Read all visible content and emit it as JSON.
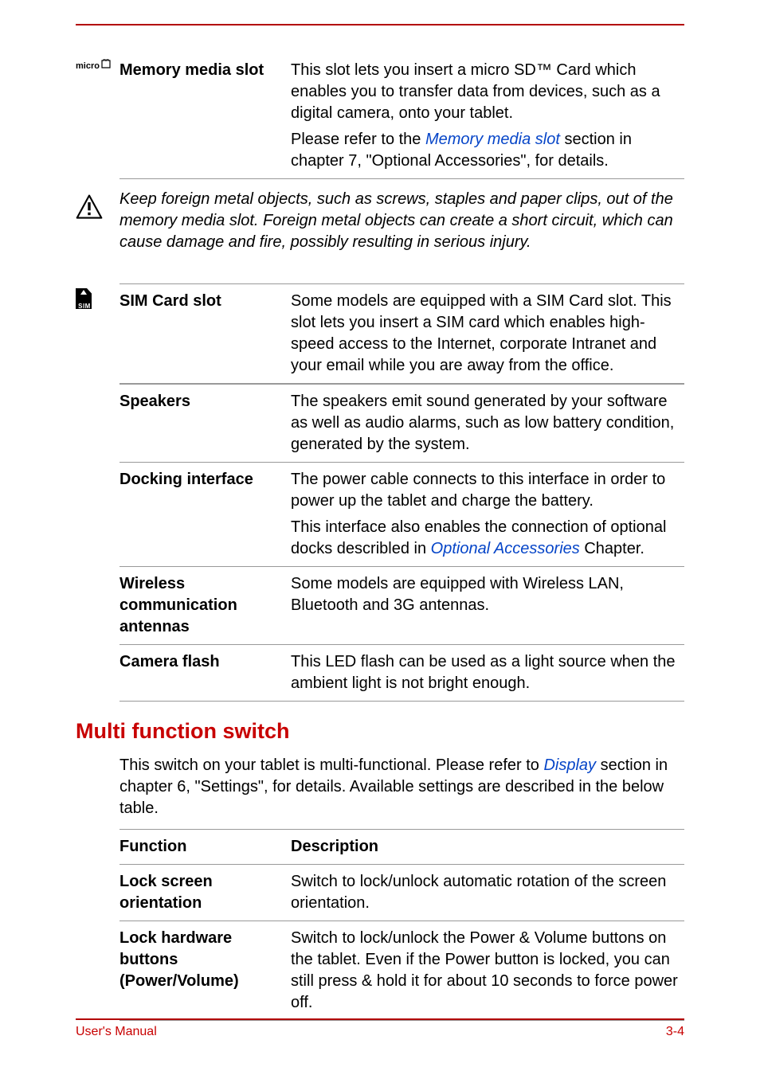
{
  "slot1": {
    "label": "Memory media slot",
    "p1a": "This slot lets you insert a micro SD™ Card which enables you to transfer data from devices, such as a digital camera, onto your tablet.",
    "p2a": "Please refer to the ",
    "p2link": "Memory media slot",
    "p2b": " section in chapter 7, \"Optional Accessories\", for details."
  },
  "warning": {
    "text": "Keep foreign metal objects, such as screws, staples and paper clips, out of the memory media slot. Foreign metal objects can create a short circuit, which can cause damage and fire, possibly resulting in serious injury."
  },
  "sim": {
    "label": "SIM Card slot",
    "p1": "Some models are equipped with a SIM Card slot. This slot lets you insert a SIM card which enables high-speed access to the Internet, corporate Intranet and your email while you are away from the office."
  },
  "speakers": {
    "label": "Speakers",
    "p1": "The speakers emit sound generated by your software as well as audio alarms, such as low battery condition, generated by the system."
  },
  "docking": {
    "label": "Docking interface",
    "p1": "The power cable connects to this interface in order to power up the tablet and charge the battery.",
    "p2a": "This interface also enables the connection of optional docks describled in ",
    "p2link": "Optional Accessories",
    "p2b": " Chapter."
  },
  "wireless": {
    "label": "Wireless communication antennas",
    "p1": "Some models are equipped with Wireless LAN, Bluetooth and 3G antennas."
  },
  "cameraflash": {
    "label": "Camera flash",
    "p1": "This LED flash can be used as a light source when the ambient light is not bright enough."
  },
  "section": {
    "title": "Multi function switch",
    "intro_a": "This switch on your tablet is multi-functional. Please refer to ",
    "intro_link": "Display",
    "intro_b": " section in chapter 6, \"Settings\", for details. Available settings are described in the below table."
  },
  "table": {
    "h_func": "Function",
    "h_desc": "Description",
    "r1_func": "Lock screen orientation",
    "r1_desc": "Switch to lock/unlock automatic rotation of the screen orientation.",
    "r2_func": "Lock hardware buttons (Power/Volume)",
    "r2_desc": "Switch to lock/unlock the Power & Volume buttons on the tablet. Even if the Power button is locked, you can still press & hold it for about 10 seconds to force power off."
  },
  "footer": {
    "left": "User's Manual",
    "right": "3-4"
  },
  "icons": {
    "micro": "micro",
    "sim": "SIM"
  }
}
